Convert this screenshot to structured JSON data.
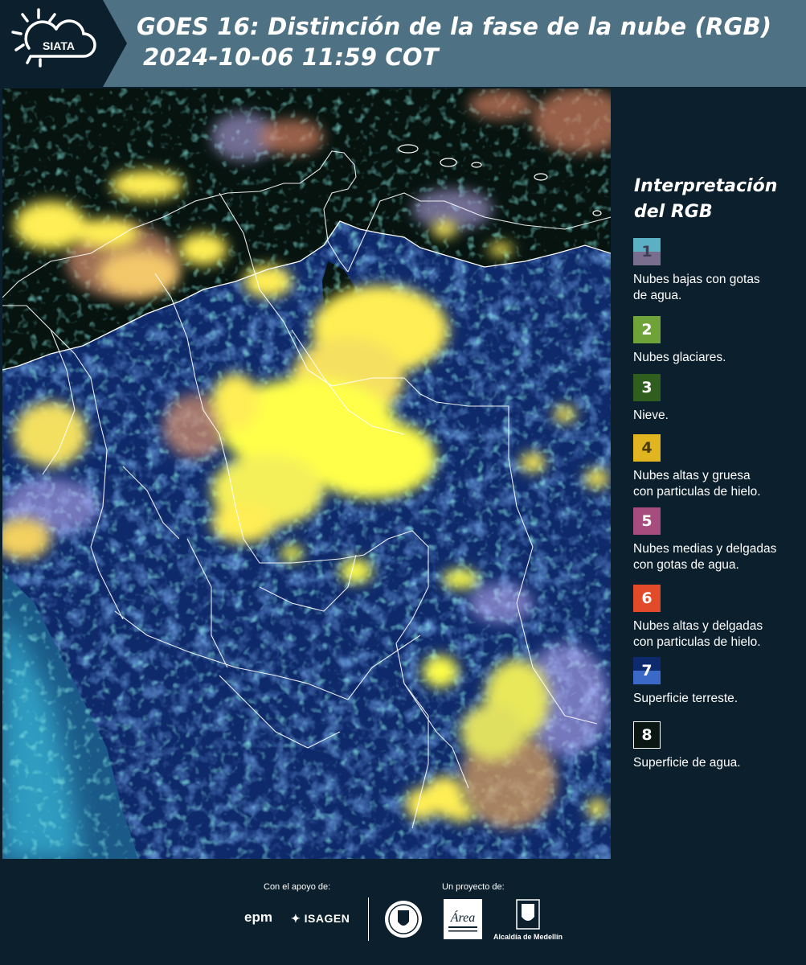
{
  "header": {
    "title_line1": "GOES 16: Distinción de la fase de la nube (RGB)",
    "title_line2": "2024-10-06 11:59 COT",
    "logo_text": "SIATA",
    "background_color": "#4e7283",
    "logo_background_color": "#0c1f2c"
  },
  "legend": {
    "title_line1": "Interpretación",
    "title_line2": "del RGB",
    "items": [
      {
        "number": "1",
        "label": "Nubes bajas con gotas de agua.",
        "label_line1": "Nubes bajas con gotas",
        "label_line2": "de agua.",
        "color_top": "#5bb0c4",
        "color_bottom": "#7a6e8e"
      },
      {
        "number": "2",
        "label": "Nubes glaciares.",
        "label_line1": "Nubes glaciares.",
        "label_line2": "",
        "color_top": "#6fa33a",
        "color_bottom": "#6fa33a"
      },
      {
        "number": "3",
        "label": "Nieve.",
        "label_line1": "Nieve.",
        "label_line2": "",
        "color_top": "#2f5e1f",
        "color_bottom": "#2f5e1f"
      },
      {
        "number": "4",
        "label": "Nubes altas y gruesa con particulas de hielo.",
        "label_line1": "Nubes altas y gruesa",
        "label_line2": "con particulas de hielo.",
        "color_top": "#e0b51f",
        "color_bottom": "#e0b51f"
      },
      {
        "number": "5",
        "label": "Nubes medias y delgadas con gotas de agua.",
        "label_line1": "Nubes medias y delgadas",
        "label_line2": "con gotas de agua.",
        "color_top": "#a64d7e",
        "color_bottom": "#a64d7e"
      },
      {
        "number": "6",
        "label": "Nubes altas y delgadas con particulas de hielo.",
        "label_line1": "Nubes altas y delgadas",
        "label_line2": "con particulas de hielo.",
        "color_top": "#e24b2a",
        "color_bottom": "#e24b2a"
      },
      {
        "number": "7",
        "label": "Superficie terreste.",
        "label_line1": "Superficie terreste.",
        "label_line2": "",
        "color_top": "#0e2a6e",
        "color_bottom": "#3b69c7"
      },
      {
        "number": "8",
        "label": "Superficie de agua.",
        "label_line1": "Superficie de agua.",
        "label_line2": "",
        "color_top": "#0b1712",
        "color_bottom": "#0b1712"
      }
    ]
  },
  "footer": {
    "support_caption": "Con el apoyo de:",
    "project_caption": "Un proyecto de:",
    "epm_text": "epm",
    "isagen_text": "ISAGEN",
    "alcaldia_text": "Alcaldía de Medellín",
    "area_text": "Área"
  },
  "map": {
    "land_color": "#0d2050",
    "ocean_color": "#071712",
    "cloud_colors": [
      "#ffff4a",
      "#f3c86a",
      "#c97a5d",
      "#79e9d8",
      "#3be8ff",
      "#c9b8ff"
    ]
  }
}
